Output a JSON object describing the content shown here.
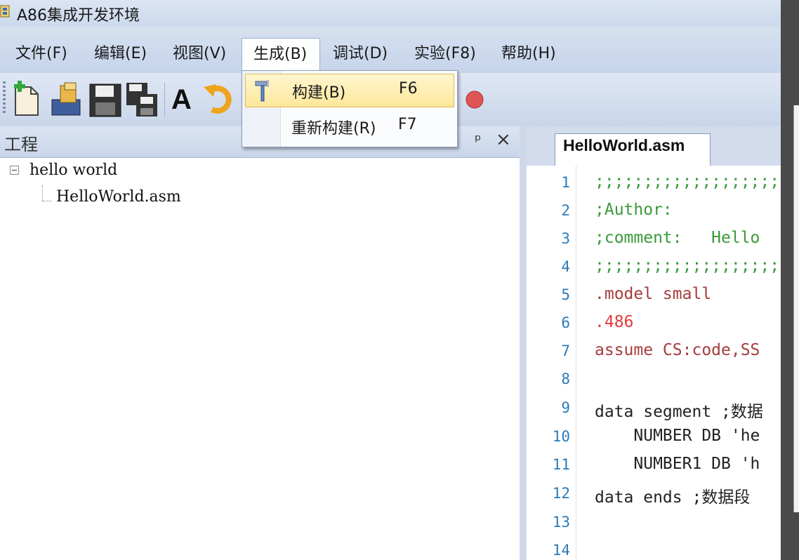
{
  "window": {
    "title": "A86集成开发环境",
    "app_icon": "window-icon"
  },
  "menubar": {
    "items": [
      {
        "label": "文件(F)"
      },
      {
        "label": "编辑(E)"
      },
      {
        "label": "视图(V)"
      },
      {
        "label": "生成(B)",
        "open": true
      },
      {
        "label": "调试(D)"
      },
      {
        "label": "实验(F8)"
      },
      {
        "label": "帮助(H)"
      }
    ]
  },
  "build_menu": {
    "items": [
      {
        "label": "构建(B)",
        "shortcut": "F6",
        "icon": "build-hammer-icon",
        "highlighted": true
      },
      {
        "label": "重新构建(R)",
        "shortcut": "F7"
      }
    ]
  },
  "toolbar": {
    "buttons": [
      "new-file-icon",
      "open-folder-icon",
      "save-icon",
      "save-all-icon",
      "font-icon",
      "undo-icon",
      "stop-icon"
    ],
    "font_glyph": "A"
  },
  "project_pane": {
    "title": "工程",
    "pin_glyph": "ᵖ",
    "close_glyph": "×",
    "tree": {
      "root": "hello world",
      "children": [
        "HelloWorld.asm"
      ]
    }
  },
  "editor": {
    "tab": "HelloWorld.asm",
    "lines": [
      {
        "n": "1",
        "text": ";;;;;;;;;;;;;;;;;;;;"
      },
      {
        "n": "2",
        "text": ";Author:"
      },
      {
        "n": "3",
        "text": ";comment:   Hello"
      },
      {
        "n": "4",
        "text": ";;;;;;;;;;;;;;;;;;;;"
      },
      {
        "n": "5",
        "text": ".model small"
      },
      {
        "n": "6",
        "text": ".486"
      },
      {
        "n": "7",
        "text": "assume CS:code,SS"
      },
      {
        "n": "8",
        "text": ""
      },
      {
        "n": "9",
        "text": "data segment ;数据"
      },
      {
        "n": "10",
        "text": "    NUMBER DB 'he"
      },
      {
        "n": "11",
        "text": "    NUMBER1 DB 'h"
      },
      {
        "n": "12",
        "text": "data ends ;数据段"
      },
      {
        "n": "13",
        "text": ""
      },
      {
        "n": "14",
        "text": ""
      }
    ]
  },
  "colors": {
    "comment": "#3a9a3a",
    "directive": "#a63c3c",
    "number": "#e33b3b",
    "register": "#2a85c9",
    "string": "#c019c0",
    "line_number": "#2b7bb8"
  }
}
